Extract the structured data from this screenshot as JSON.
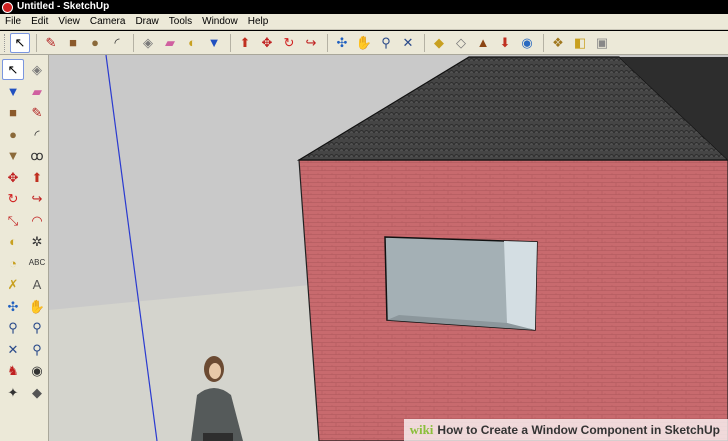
{
  "window": {
    "title": "Untitled - SketchUp"
  },
  "menu": [
    "File",
    "Edit",
    "View",
    "Camera",
    "Draw",
    "Tools",
    "Window",
    "Help"
  ],
  "toolbar": [
    {
      "name": "select-tool-icon",
      "glyph": "↖",
      "color": "#000000",
      "active": true
    },
    {
      "sep": true
    },
    {
      "name": "pencil-line-tool-icon",
      "glyph": "✎",
      "color": "#b22222"
    },
    {
      "name": "rectangle-tool-icon",
      "glyph": "■",
      "color": "#8b5a2b"
    },
    {
      "name": "circle-tool-icon",
      "glyph": "●",
      "color": "#8b6a3a"
    },
    {
      "name": "arc-tool-icon",
      "glyph": "◜",
      "color": "#333333"
    },
    {
      "sep": true
    },
    {
      "name": "make-component-icon",
      "glyph": "◈",
      "color": "#7a7a7a"
    },
    {
      "name": "eraser-tool-icon",
      "glyph": "▰",
      "color": "#d060a0"
    },
    {
      "name": "tape-measure-icon",
      "glyph": "◐",
      "color": "#c8a020"
    },
    {
      "name": "paint-bucket-icon",
      "glyph": "▼",
      "color": "#2050c0"
    },
    {
      "sep": true
    },
    {
      "name": "push-pull-tool-icon",
      "glyph": "⬆",
      "color": "#c03020"
    },
    {
      "name": "move-tool-icon",
      "glyph": "✥",
      "color": "#c02020"
    },
    {
      "name": "rotate-tool-icon",
      "glyph": "↻",
      "color": "#d02020"
    },
    {
      "name": "follow-me-tool-icon",
      "glyph": "↪",
      "color": "#c02020"
    },
    {
      "sep": true
    },
    {
      "name": "orbit-tool-icon",
      "glyph": "✣",
      "color": "#2060c0"
    },
    {
      "name": "pan-tool-icon",
      "glyph": "✋",
      "color": "#555555"
    },
    {
      "name": "zoom-tool-icon",
      "glyph": "⚲",
      "color": "#2a4a8a"
    },
    {
      "name": "zoom-extents-icon",
      "glyph": "✕",
      "color": "#2a4a8a"
    },
    {
      "sep": true
    },
    {
      "name": "add-location-icon",
      "glyph": "◆",
      "color": "#c8a020"
    },
    {
      "name": "toggle-terrain-icon",
      "glyph": "◇",
      "color": "#777777"
    },
    {
      "name": "get-models-icon",
      "glyph": "▲",
      "color": "#8b4513"
    },
    {
      "name": "share-model-icon",
      "glyph": "⬇",
      "color": "#c03020"
    },
    {
      "name": "google-earth-icon",
      "glyph": "◉",
      "color": "#2a6ac0"
    },
    {
      "sep": true
    },
    {
      "name": "components-icon",
      "glyph": "❖",
      "color": "#a0781e"
    },
    {
      "name": "materials-icon",
      "glyph": "◧",
      "color": "#c8a020"
    },
    {
      "name": "styles-icon",
      "glyph": "▣",
      "color": "#888888"
    }
  ],
  "sidebar": [
    {
      "name": "select-tool-icon",
      "glyph": "↖",
      "color": "#000000",
      "active": true
    },
    {
      "name": "make-component-icon",
      "glyph": "◈",
      "color": "#7a7a7a"
    },
    {
      "name": "paint-bucket-icon",
      "glyph": "▼",
      "color": "#2050c0"
    },
    {
      "name": "eraser-tool-icon",
      "glyph": "▰",
      "color": "#d060a0"
    },
    {
      "name": "rectangle-tool-icon",
      "glyph": "■",
      "color": "#8b5a2b"
    },
    {
      "name": "pencil-line-tool-icon",
      "glyph": "✎",
      "color": "#b22222"
    },
    {
      "name": "circle-tool-icon",
      "glyph": "●",
      "color": "#8b6a3a"
    },
    {
      "name": "arc-tool-icon",
      "glyph": "◜",
      "color": "#333333"
    },
    {
      "name": "polygon-tool-icon",
      "glyph": "▼",
      "color": "#8b6a3a"
    },
    {
      "name": "freehand-tool-icon",
      "glyph": "ꝏ",
      "color": "#333333"
    },
    {
      "name": "move-tool-icon",
      "glyph": "✥",
      "color": "#c02020"
    },
    {
      "name": "push-pull-tool-icon",
      "glyph": "⬆",
      "color": "#c03020"
    },
    {
      "name": "rotate-tool-icon",
      "glyph": "↻",
      "color": "#d02020"
    },
    {
      "name": "follow-me-tool-icon",
      "glyph": "↪",
      "color": "#c02020"
    },
    {
      "name": "scale-tool-icon",
      "glyph": "⤡",
      "color": "#c02020"
    },
    {
      "name": "offset-tool-icon",
      "glyph": "◠",
      "color": "#c02020"
    },
    {
      "name": "tape-measure-icon",
      "glyph": "◐",
      "color": "#c8a020"
    },
    {
      "name": "dimension-tool-icon",
      "glyph": "✲",
      "color": "#333333"
    },
    {
      "name": "protractor-tool-icon",
      "glyph": "◔",
      "color": "#c8a020"
    },
    {
      "name": "text-tool-icon",
      "glyph": "ABC",
      "color": "#333333"
    },
    {
      "name": "axes-tool-icon",
      "glyph": "✗",
      "color": "#c8a020"
    },
    {
      "name": "3d-text-tool-icon",
      "glyph": "A",
      "color": "#555555"
    },
    {
      "name": "orbit-tool-icon",
      "glyph": "✣",
      "color": "#2060c0"
    },
    {
      "name": "pan-tool-icon",
      "glyph": "✋",
      "color": "#555555"
    },
    {
      "name": "zoom-tool-icon",
      "glyph": "⚲",
      "color": "#2a4a8a"
    },
    {
      "name": "zoom-window-icon",
      "glyph": "⚲",
      "color": "#2a4a8a"
    },
    {
      "name": "zoom-extents-icon",
      "glyph": "✕",
      "color": "#2a4a8a"
    },
    {
      "name": "previous-view-icon",
      "glyph": "⚲",
      "color": "#2a4a8a"
    },
    {
      "name": "position-camera-icon",
      "glyph": "♞",
      "color": "#c02020"
    },
    {
      "name": "look-around-icon",
      "glyph": "◉",
      "color": "#333333"
    },
    {
      "name": "walk-tool-icon",
      "glyph": "✦",
      "color": "#333333"
    },
    {
      "name": "section-plane-icon",
      "glyph": "◆",
      "color": "#555555"
    }
  ],
  "colors": {
    "sky": "#c9c9c9",
    "ground": "#dcdcd4",
    "wall": "#c86a6e",
    "roof": "#3c3c3c",
    "window_glass": "#a4b0b5",
    "blue_axis": "#2a3ad0"
  },
  "watermark": {
    "brand": "wiki",
    "text": "How to Create a Window Component in SketchUp"
  }
}
